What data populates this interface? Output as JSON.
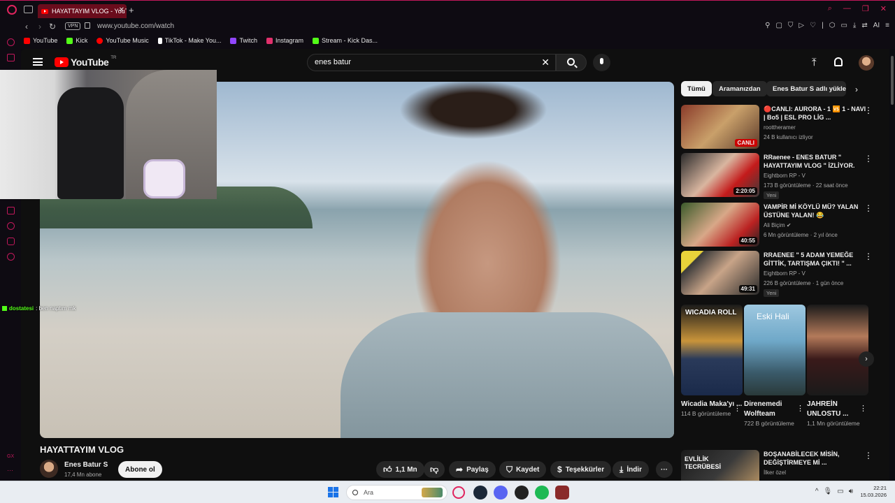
{
  "browser": {
    "tab_title": "HAYATTAYIM VLOG - YouT",
    "url": "www.youtube.com/watch",
    "vpn_label": "VPN",
    "ai_label": "AI",
    "bookmarks": [
      {
        "label": "YouTube",
        "color": "#ff0000"
      },
      {
        "label": "Kick",
        "color": "#53fc18"
      },
      {
        "label": "YouTube Music",
        "color": "#ff0000"
      },
      {
        "label": "TikTok - Make You...",
        "color": "#ffffff"
      },
      {
        "label": "Twitch",
        "color": "#9146ff"
      },
      {
        "label": "Instagram",
        "color": "#e1306c"
      },
      {
        "label": "Stream - Kick Das...",
        "color": "#53fc18"
      }
    ],
    "accent": "#e0245e"
  },
  "yt": {
    "logo_text": "YouTube",
    "region": "TR",
    "search_value": "enes batur",
    "video_title": "HAYATTAYIM VLOG",
    "channel_name": "Enes Batur S",
    "channel_subs": "17,4 Mn abone",
    "subscribe_label": "Abone ol",
    "actions": {
      "likes": "1,1 Mn",
      "share": "Paylaş",
      "save": "Kaydet",
      "thanks": "Teşekkürler",
      "download": "İndir"
    },
    "chips": [
      "Tümü",
      "Aramanızdan",
      "Enes Batur S adlı yükley"
    ],
    "recommendations": [
      {
        "title": "🔴CANLI: AURORA - 1 🆚 1 - NAVI | Bo5 | ESL PRO LİG ...",
        "channel": "roottheramer",
        "meta": "24 B kullanıcı izliyor",
        "badge": "",
        "duration": "CANLI",
        "live": true
      },
      {
        "title": "RRaenee - ENES BATUR \" HAYATTAYIM VLOG \" İZLİYOR.",
        "channel": "Eightborn RP - V",
        "meta": "173 B görüntüleme · 22 saat önce",
        "badge": "Yeni",
        "duration": "2:20:05",
        "live": false
      },
      {
        "title": "VAMPİR Mİ KÖYLÜ MÜ? YALAN ÜSTÜNE YALAN! 😂",
        "channel": "Ali Biçim ✔",
        "meta": "6 Mn görüntüleme · 2 yıl önce",
        "badge": "",
        "duration": "40:55",
        "live": false
      },
      {
        "title": "RRAENEE \" 5 ADAM YEMEĞE GİTTİK, TARTIŞMA ÇIKTI! \" ...",
        "channel": "Eightborn RP - V",
        "meta": "226 B görüntüleme · 1 gün önce",
        "badge": "Yeni",
        "duration": "49:31",
        "live": false
      }
    ],
    "shorts": [
      {
        "title": "Wicadia Maka'yı ...",
        "views": "114 B görüntüleme",
        "overlay": "WICADIA ROLL"
      },
      {
        "title": "Direnemedi Wolfteam",
        "views": "722 B görüntüleme",
        "overlay": "Eski Hali"
      },
      {
        "title": "JAHREİN UNLOSTU ...",
        "views": "1,1 Mn görüntüleme",
        "overlay": ""
      }
    ],
    "bottom_rec": {
      "title": "BOŞANABİLECEK MİSİN, DEĞİŞTİRMEYE Mİ ...",
      "channel": "İlker özel",
      "overlay": "EVLİLİK TECRÜBESİ"
    }
  },
  "chat": {
    "user": "dostatesi",
    "message": ": ben naptım mk"
  },
  "taskbar": {
    "search_placeholder": "Ara",
    "time": "22:21",
    "date": "15.03.2026"
  }
}
